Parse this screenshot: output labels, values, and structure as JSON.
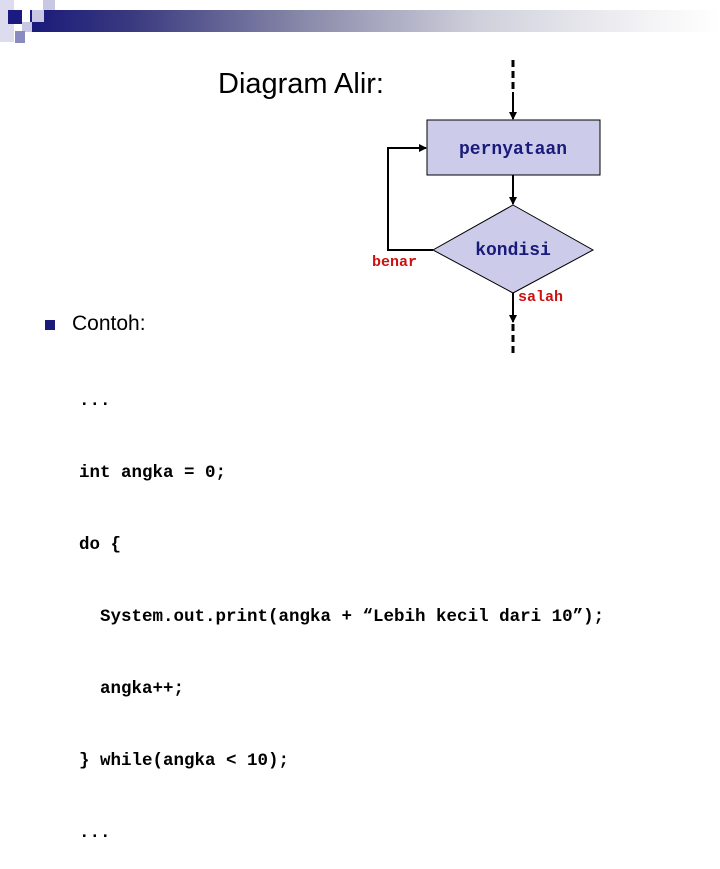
{
  "slide": {
    "title": "Diagram Alir:",
    "colors": {
      "banner_start": "#1a1a7a",
      "box_fill": "#ccccea",
      "label_red": "#cc1111",
      "node_text": "#1a1a7a"
    }
  },
  "flowchart": {
    "nodes": [
      {
        "id": "statement",
        "shape": "rectangle",
        "label": "pernyataan"
      },
      {
        "id": "condition",
        "shape": "diamond",
        "label": "kondisi"
      }
    ],
    "edges": [
      {
        "from": "entry",
        "to": "statement",
        "style": "dashed-then-solid"
      },
      {
        "from": "statement",
        "to": "condition",
        "style": "solid"
      },
      {
        "from": "condition",
        "to": "statement",
        "label": "benar"
      },
      {
        "from": "condition",
        "to": "exit",
        "label": "salah",
        "style": "solid-then-dashed"
      }
    ],
    "labels": {
      "true_branch": "benar",
      "false_branch": "salah"
    }
  },
  "example": {
    "heading": "Contoh:",
    "code_lines": [
      "...",
      "int angka = 0;",
      "do {",
      "  System.out.print(angka + “Lebih kecil dari 10”);",
      "  angka++;",
      "} while(angka < 10);",
      "..."
    ]
  }
}
